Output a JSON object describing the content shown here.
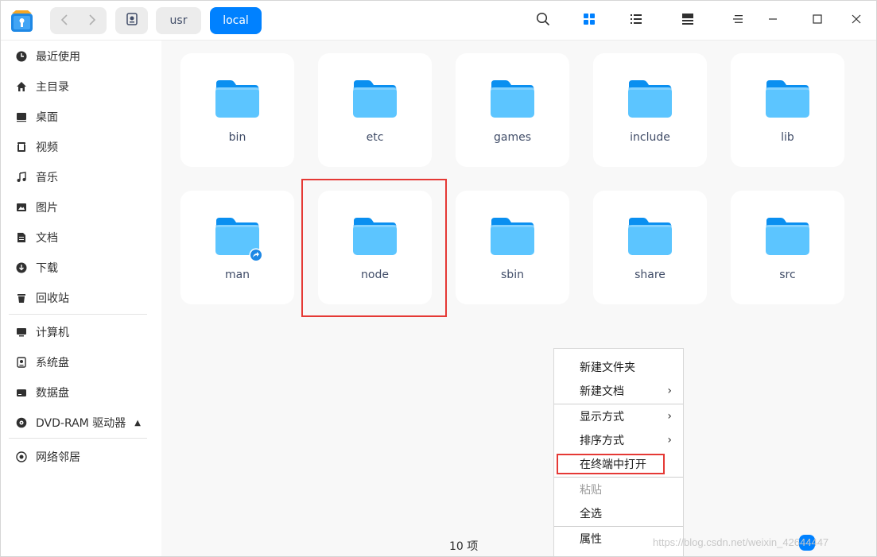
{
  "titlebar": {
    "back_icon": "chevron-left-icon",
    "forward_icon": "chevron-right-icon",
    "breadcrumbs": [
      {
        "label": "usr"
      },
      {
        "label": "local"
      }
    ],
    "tools": [
      "search-icon",
      "icon-view-icon",
      "list-view-icon",
      "detail-view-icon",
      "menu-icon",
      "minimize-icon",
      "maximize-icon",
      "close-icon"
    ]
  },
  "sidebar": {
    "items": [
      {
        "label": "最近使用",
        "icon": "clock-icon"
      },
      {
        "label": "主目录",
        "icon": "home-icon"
      },
      {
        "label": "桌面",
        "icon": "desktop-icon"
      },
      {
        "label": "视频",
        "icon": "video-icon"
      },
      {
        "label": "音乐",
        "icon": "music-icon"
      },
      {
        "label": "图片",
        "icon": "picture-icon"
      },
      {
        "label": "文档",
        "icon": "document-icon"
      },
      {
        "label": "下载",
        "icon": "download-icon"
      },
      {
        "label": "回收站",
        "icon": "trash-icon"
      },
      {
        "label": "计算机",
        "icon": "computer-icon"
      },
      {
        "label": "系统盘",
        "icon": "system-disk-icon"
      },
      {
        "label": "数据盘",
        "icon": "data-disk-icon"
      },
      {
        "label": "DVD-RAM 驱动器",
        "icon": "dvd-icon"
      },
      {
        "label": "网络邻居",
        "icon": "network-icon"
      }
    ]
  },
  "files": [
    {
      "name": "bin"
    },
    {
      "name": "etc"
    },
    {
      "name": "games"
    },
    {
      "name": "include"
    },
    {
      "name": "lib"
    },
    {
      "name": "man",
      "symlink": true
    },
    {
      "name": "node"
    },
    {
      "name": "sbin"
    },
    {
      "name": "share"
    },
    {
      "name": "src"
    }
  ],
  "status": {
    "count": "10 项"
  },
  "context_menu": {
    "items": [
      {
        "label": "新建文件夹"
      },
      {
        "label": "新建文档",
        "submenu": true
      },
      {
        "label": "显示方式",
        "submenu": true
      },
      {
        "label": "排序方式",
        "submenu": true
      },
      {
        "label": "在终端中打开"
      },
      {
        "label": "粘贴",
        "disabled": true
      },
      {
        "label": "全选"
      },
      {
        "label": "属性"
      }
    ],
    "submenu_arrow": "›"
  },
  "watermark": "https://blog.csdn.net/weixin_42644447",
  "colors": {
    "accent": "#0081ff",
    "highlight": "#e53935",
    "folder_light": "#5cc5ff",
    "folder_dark": "#0a8ff0"
  }
}
